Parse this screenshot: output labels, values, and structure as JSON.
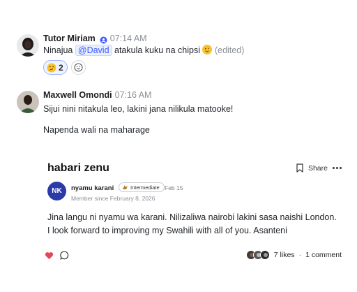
{
  "messages": [
    {
      "author": "Tutor Miriam",
      "time": "07:14 AM",
      "text_before": "Ninajua ",
      "mention": "@David",
      "text_after": " atakula kuku na chipsi",
      "edited": "(edited)",
      "reaction_count": "2"
    },
    {
      "author": "Maxwell Omondi",
      "time": "07:16 AM",
      "line1": "Sijui nini nitakula leo, lakini jana nilikula matooke!",
      "line2": "Napenda wali na maharage"
    }
  ],
  "post": {
    "title": "habari zenu",
    "share_label": "Share",
    "initials": "NK",
    "username": "nyamu karani",
    "level": "Intermediate",
    "date": "Feb 15",
    "member_since": "Member since February 8, 2026",
    "body": "Jina langu ni nyamu wa karani. Nilizaliwa nairobi lakini sasa naishi London. I look forward to improving my Swahili with all of you. Asanteni",
    "likes": "7 likes",
    "separator": "·",
    "comments": "1 comment"
  },
  "colors": {
    "mention_bg": "#e8efff",
    "mention_text": "#3d5afe",
    "avatar_nk": "#2a3aa8",
    "heart": "#e8455b",
    "verified": "#3d5afe"
  }
}
